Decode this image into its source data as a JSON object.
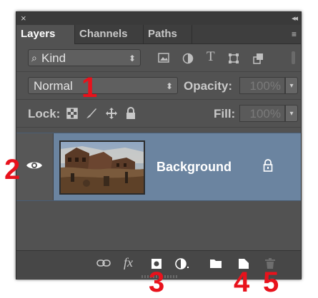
{
  "panel": {
    "close_glyph": "×",
    "collapse_glyph": "◂◂",
    "menu_glyph": "≡"
  },
  "tabs": [
    {
      "label": "Layers",
      "active": true
    },
    {
      "label": "Channels",
      "active": false
    },
    {
      "label": "Paths",
      "active": false
    }
  ],
  "filter": {
    "kind_label": "Kind",
    "icons": [
      "image-filter-icon",
      "adjustment-filter-icon",
      "type-filter-icon",
      "shape-filter-icon",
      "smart-object-filter-icon"
    ]
  },
  "blend": {
    "mode": "Normal",
    "opacity_label": "Opacity:",
    "opacity_value": "100%"
  },
  "lock": {
    "label": "Lock:",
    "fill_label": "Fill:",
    "fill_value": "100%",
    "icons": [
      "lock-transparent-icon",
      "lock-image-pixels-icon",
      "lock-position-icon",
      "lock-all-icon"
    ]
  },
  "layers": [
    {
      "name": "Background",
      "visible": true,
      "locked": true,
      "selected": true
    }
  ],
  "bottom_icons": [
    "link-layers-icon",
    "fx-icon",
    "add-mask-icon",
    "adjustment-layer-icon",
    "new-group-icon",
    "new-layer-icon",
    "delete-layer-icon"
  ],
  "bottom_fx_label": "fx",
  "annotations": {
    "n1": "1",
    "n2": "2",
    "n3": "3",
    "n4": "4",
    "n5": "5"
  },
  "colors": {
    "annotation": "#e8121c",
    "selected_layer": "#6b84a0",
    "panel": "#525252"
  }
}
